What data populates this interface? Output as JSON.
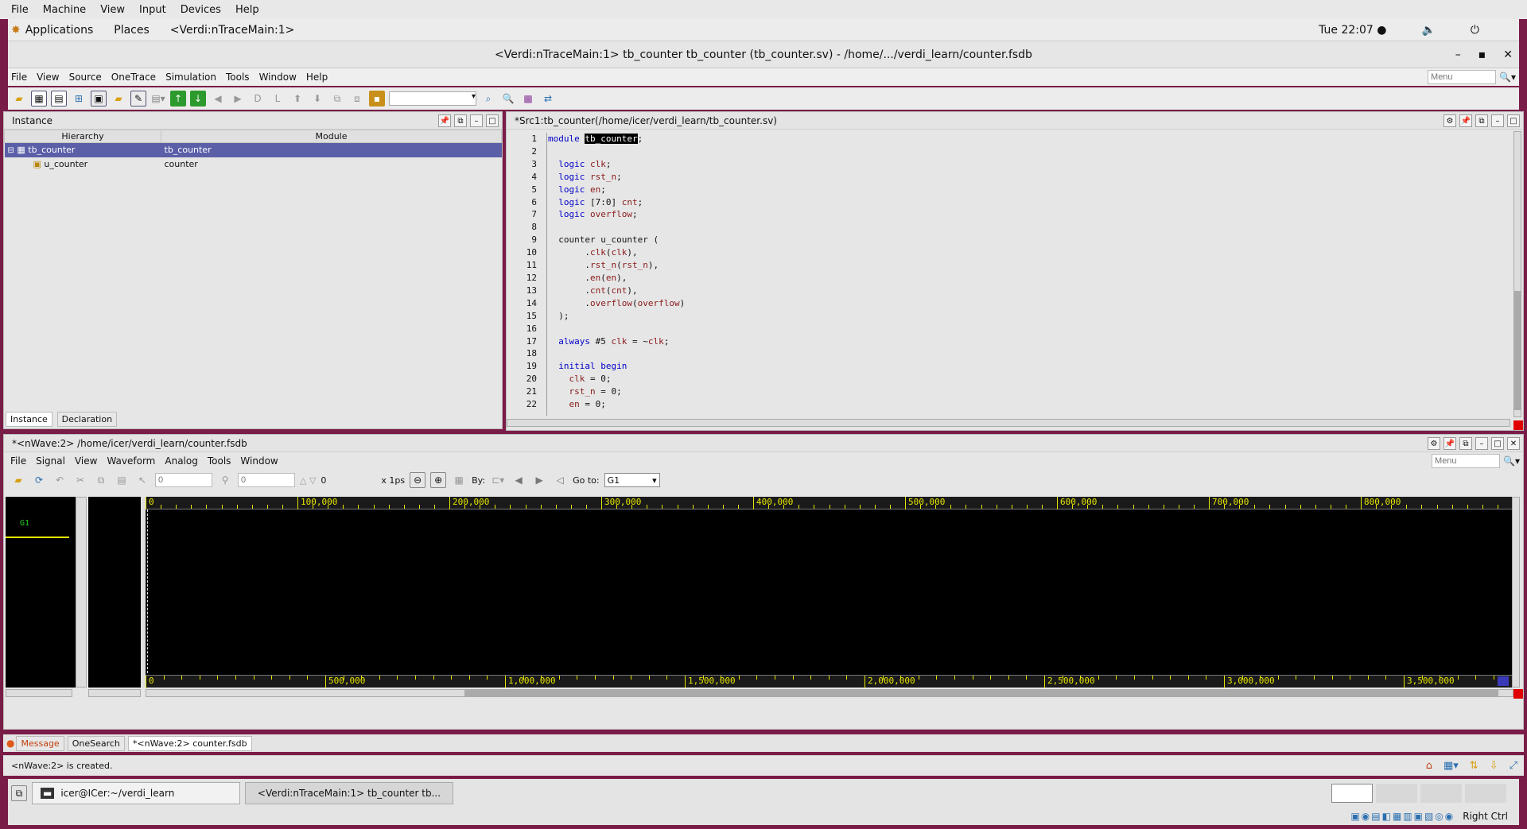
{
  "vm_menu": [
    "File",
    "Machine",
    "View",
    "Input",
    "Devices",
    "Help"
  ],
  "desktop": {
    "applications": "Applications",
    "places": "Places",
    "active_app": "<Verdi:nTraceMain:1>",
    "clock": "Tue 22:07 ●"
  },
  "window": {
    "title": "<Verdi:nTraceMain:1> tb_counter tb_counter (tb_counter.sv) - /home/.../verdi_learn/counter.fsdb",
    "min": "–",
    "max": "▪",
    "close": "✕"
  },
  "app_menu": [
    "File",
    "View",
    "Source",
    "OneTrace",
    "Simulation",
    "Tools",
    "Window",
    "Help"
  ],
  "menu_search_placeholder": "Menu",
  "instance_panel": {
    "title": "Instance",
    "col_hierarchy": "Hierarchy",
    "col_module": "Module",
    "rows": [
      {
        "name": "tb_counter",
        "module": "tb_counter"
      },
      {
        "name": "u_counter",
        "module": "counter"
      }
    ],
    "tabs": [
      "Instance",
      "Declaration"
    ]
  },
  "source_panel": {
    "title": "*Src1:tb_counter(/home/icer/verdi_learn/tb_counter.sv)",
    "lines": [
      "module tb_counter;",
      "",
      "  logic clk;",
      "  logic rst_n;",
      "  logic en;",
      "  logic [7:0] cnt;",
      "  logic overflow;",
      "",
      "  counter u_counter (",
      "       .clk(clk),",
      "       .rst_n(rst_n),",
      "       .en(en),",
      "       .cnt(cnt),",
      "       .overflow(overflow)",
      "  );",
      "",
      "  always #5 clk = ~clk;",
      "",
      "  initial begin",
      "    clk = 0;",
      "    rst_n = 0;",
      "    en = 0;"
    ]
  },
  "nwave": {
    "title": "*<nWave:2> /home/icer/verdi_learn/counter.fsdb",
    "menu": [
      "File",
      "Signal",
      "View",
      "Waveform",
      "Analog",
      "Tools",
      "Window"
    ],
    "cursor_a": "0",
    "cursor_b": "0",
    "delta": "0",
    "unit": "x 1ps",
    "by_label": "By:",
    "goto_label": "Go to:",
    "goto_value": "G1",
    "group_label": "G1",
    "top_ruler": [
      "0",
      "100,000",
      "200,000",
      "300,000",
      "400,000",
      "500,000",
      "600,000",
      "700,000",
      "800,000"
    ],
    "bottom_ruler": [
      "0",
      "500,000",
      "1,000,000",
      "1,500,000",
      "2,000,000",
      "2,500,000",
      "3,000,000",
      "3,500,000"
    ]
  },
  "bottom_tabs": [
    "Message",
    "OneSearch",
    "*<nWave:2> counter.fsdb"
  ],
  "status_message": "<nWave:2> is created.",
  "taskbar": {
    "terminal": "icer@ICer:~/verdi_learn",
    "verdi": "<Verdi:nTraceMain:1> tb_counter tb..."
  },
  "host_key": "Right Ctrl"
}
